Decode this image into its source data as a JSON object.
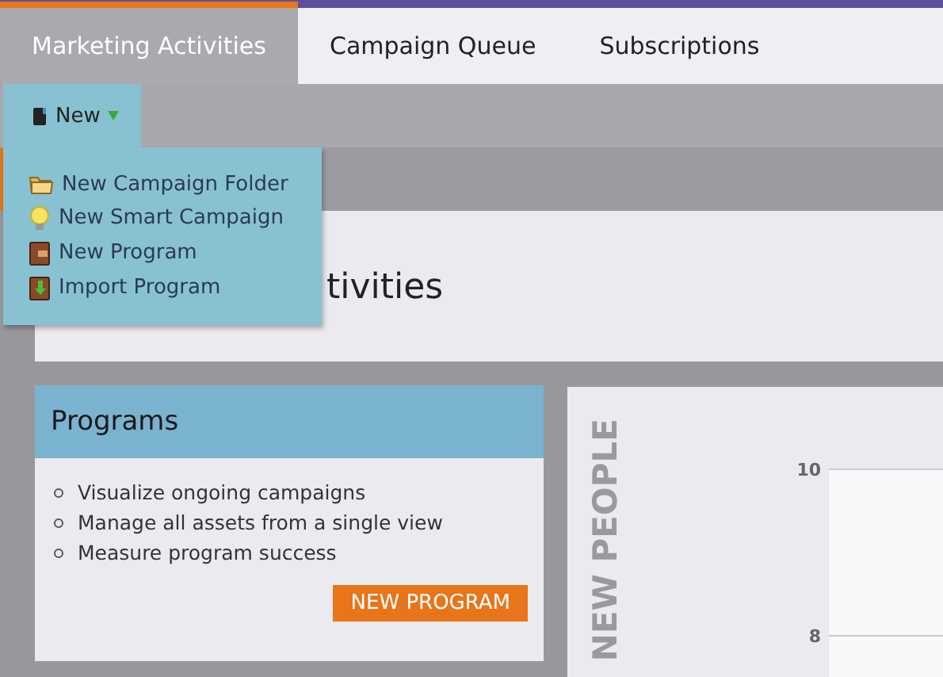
{
  "tabs": [
    {
      "label": "Marketing Activities",
      "selected": true
    },
    {
      "label": "Campaign Queue",
      "selected": false
    },
    {
      "label": "Subscriptions",
      "selected": false
    }
  ],
  "toolbar": {
    "new_button": {
      "label": "New",
      "expanded": true
    }
  },
  "menu": [
    {
      "label": "New Campaign Folder",
      "kind": "folder"
    },
    {
      "label": "New Smart Campaign",
      "kind": "bulb"
    },
    {
      "label": "New Program",
      "kind": "program"
    },
    {
      "label": "Import Program",
      "kind": "import"
    }
  ],
  "page_title": "tivities",
  "programs_card": {
    "title": "Programs",
    "bullets": [
      "Visualize ongoing campaigns",
      "Manage all assets from a single view",
      "Measure program success"
    ],
    "button": "NEW PROGRAM"
  },
  "chart_panel": {
    "axis_title": "NEW PEOPLE",
    "y_ticks": [
      "10",
      "8"
    ]
  }
}
